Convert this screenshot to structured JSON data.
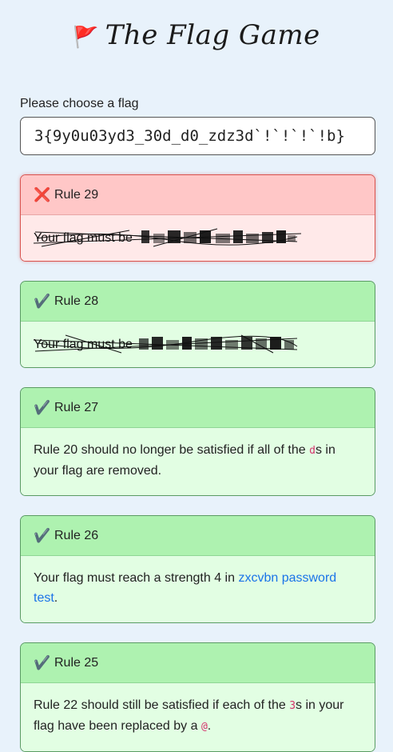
{
  "header": {
    "flag_icon": "🚩",
    "title": "The Flag Game"
  },
  "form": {
    "label": "Please choose a flag",
    "flag_value": "3{9y0u03yd3_30d_d0_zdz3d`!`!`!`!b}"
  },
  "rules": [
    {
      "status": "fail",
      "icon": "❌",
      "title": "Rule 29",
      "captcha_text": "Your flag must be"
    },
    {
      "status": "pass",
      "icon": "✔️",
      "title": "Rule 28",
      "captcha_text": "Your flag must be"
    },
    {
      "status": "pass",
      "icon": "✔️",
      "title": "Rule 27",
      "text_a": "Rule 20 should no longer be satisfied if all of the ",
      "code": "d",
      "text_b": "s in your flag are removed."
    },
    {
      "status": "pass",
      "icon": "✔️",
      "title": "Rule 26",
      "text_a": "Your flag must reach a strength 4 in ",
      "link": "zxcvbn password test",
      "text_b": "."
    },
    {
      "status": "pass",
      "icon": "✔️",
      "title": "Rule 25",
      "text_a": "Rule 22 should still be satisfied if each of the ",
      "code": "3",
      "text_b": "s in your flag have been replaced by a ",
      "code2": "@",
      "text_c": "."
    }
  ],
  "colors": {
    "page_bg": "#e8f2fb",
    "fail_head": "#ffc7c7",
    "fail_body": "#ffe9e9",
    "pass_head": "#aef2b0",
    "pass_body": "#e2fee3",
    "link": "#1a73e8",
    "code": "#d6336c"
  }
}
